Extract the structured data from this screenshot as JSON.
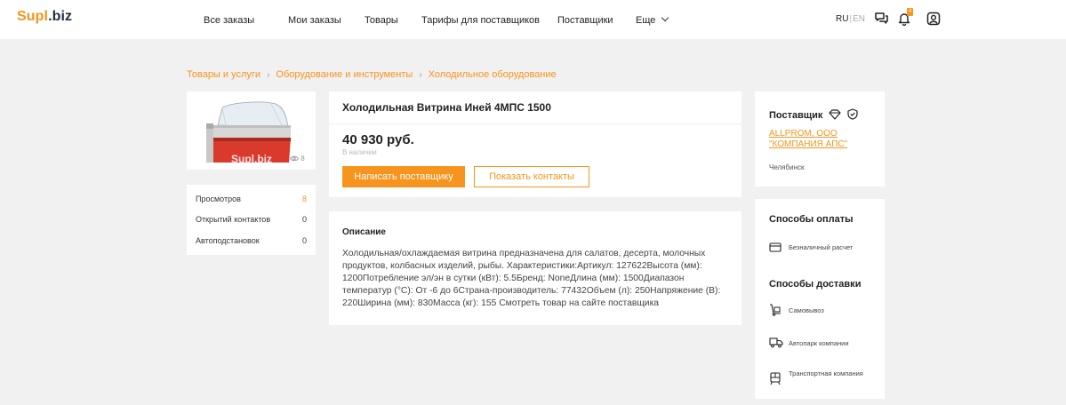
{
  "header": {
    "logo_part1": "Supl",
    "logo_part2": ".biz",
    "nav": [
      "Все заказы",
      "Мои заказы",
      "Товары",
      "Тарифы для поставщиков",
      "Поставщики",
      "Еще"
    ],
    "lang_ru": "RU",
    "lang_sep": "|",
    "lang_en": "EN",
    "notification_count": "4",
    "icons": [
      "chat-icon",
      "bell-icon",
      "profile-icon"
    ]
  },
  "breadcrumbs": [
    "Товары и услуги",
    "Оборудование и инструменты",
    "Холодильное оборудование"
  ],
  "breadcrumb_separator": "›",
  "product": {
    "title": "Холодильная Витрина Иней 4МПС 1500",
    "price": "40 930 руб.",
    "stock": "В наличии",
    "image_watermark": "Supl.biz",
    "image_views": "8",
    "write_button": "Написать поставщику",
    "contacts_button": "Показать контакты"
  },
  "stats": [
    {
      "label": "Просмотров",
      "value": "8"
    },
    {
      "label": "Открытий контактов",
      "value": "0"
    },
    {
      "label": "Автоподстановок",
      "value": "0"
    }
  ],
  "description": {
    "heading": "Описание",
    "text": "Холодильная/охлаждаемая витрина предназначена для салатов, десерта, молочных продуктов, колбасных изделий, рыбы. Характеристики:Артикул: 127622Высота (мм): 1200Потребление эл/эн в сутки (кВт): 5.5Бренд: NoneДлина (мм): 1500Диапазон температур (°С): От -6 до 6Страна-производитель: 77432Объем (л): 250Напряжение (В): 220Ширина (мм): 830Масса (кг): 155 Смотреть товар на сайте поставщика"
  },
  "supplier": {
    "heading": "Поставщик",
    "name_line1": "ALLPROM, ООО",
    "name_line2": "\"КОМПАНИЯ АПС\"",
    "city": "Челябинск"
  },
  "payment": {
    "heading": "Способы оплаты",
    "options": [
      "Безналичный расчет"
    ]
  },
  "delivery": {
    "heading": "Способы доставки",
    "options": [
      "Самовывоз",
      "Автопарк компании",
      "Транспортная компания"
    ]
  },
  "colors": {
    "accent": "#f7941d",
    "background": "#f1f1f1"
  }
}
